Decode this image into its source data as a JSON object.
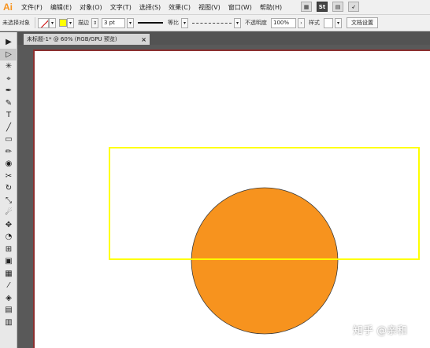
{
  "app": {
    "logo": "Ai"
  },
  "menubar": {
    "items": [
      "文件(F)",
      "编辑(E)",
      "对象(O)",
      "文字(T)",
      "选择(S)",
      "效果(C)",
      "视图(V)",
      "窗口(W)",
      "帮助(H)"
    ],
    "st_label": "St"
  },
  "controlbar": {
    "selection_status": "未选择对象",
    "stroke_label": "描边",
    "stroke_weight": "3 pt",
    "profile_label": "等比",
    "opacity_label": "不透明度",
    "opacity_value": "100%",
    "style_label": "样式",
    "doc_setup_button": "文档设置"
  },
  "tab": {
    "title": "未标题-1* @ 60% (RGB/GPU 预览)",
    "close": "×"
  },
  "tools": [
    "▶",
    "▷",
    "✳",
    "⌖",
    "✒",
    "✎",
    "T",
    "╱",
    "▭",
    "✏",
    "◉",
    "✂",
    "↻",
    "⤡",
    "☄",
    "✥",
    "◔",
    "⊞",
    "▣",
    "▦",
    "⁄",
    "◈",
    "▤",
    "▥"
  ],
  "colors": {
    "accent_orange": "#f7931e",
    "circle_fill": "#f7931e",
    "selection_yellow": "#ffff00"
  },
  "watermark": "知乎 @亲和"
}
